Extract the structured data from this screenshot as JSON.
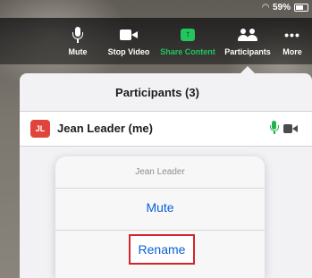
{
  "status_bar": {
    "battery": "59%"
  },
  "toolbar": {
    "mute_label": "Mute",
    "video_label": "Stop Video",
    "share_label": "Share Content",
    "participants_label": "Participants",
    "more_label": "More",
    "share_icon_glyph": "↑",
    "more_icon_glyph": "•••"
  },
  "panel": {
    "title": "Participants (3)",
    "participants": [
      {
        "initials": "JL",
        "name": "Jean Leader (me)"
      }
    ]
  },
  "action_sheet": {
    "title": "Jean Leader",
    "mute_label": "Mute",
    "rename_label": "Rename"
  },
  "colors": {
    "accent_blue": "#0a5fd6",
    "share_green": "#22c55e",
    "avatar_red": "#e0453d",
    "highlight_red": "#d4232a"
  }
}
